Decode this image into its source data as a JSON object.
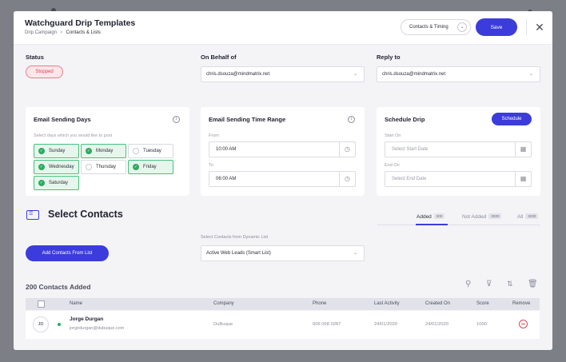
{
  "header": {
    "title": "Watchguard Drip Templates",
    "breadcrumb": [
      "Drip Campaign",
      "Contacts & Lists"
    ],
    "breadcrumb_sep": ">",
    "contacts_timing_label": "Contacts & Timing",
    "save_label": "Save",
    "close_glyph": "✕"
  },
  "status": {
    "label": "Status",
    "value": "Stopped"
  },
  "on_behalf": {
    "label": "On Behalf of",
    "value": "chris.dsouza@mindmatrix.net"
  },
  "reply_to": {
    "label": "Reply to",
    "value": "chris.dsouza@mindmatrix.net"
  },
  "sending_days": {
    "title": "Email Sending Days",
    "hint": "Select days which you would like to post",
    "days": [
      {
        "label": "Sunday",
        "selected": true
      },
      {
        "label": "Monday",
        "selected": true
      },
      {
        "label": "Tuesday",
        "selected": false
      },
      {
        "label": "Wednesday",
        "selected": true
      },
      {
        "label": "Thursday",
        "selected": false
      },
      {
        "label": "Friday",
        "selected": true
      },
      {
        "label": "Saturday",
        "selected": true
      }
    ]
  },
  "time_range": {
    "title": "Email Sending Time Range",
    "from_label": "From",
    "from_value": "10:00 AM",
    "to_label": "To",
    "to_value": "06:00 AM"
  },
  "schedule": {
    "title": "Schedule Drip",
    "button": "Schedule",
    "start_label": "Start On",
    "start_placeholder": "Select Start Date",
    "end_label": "End On",
    "end_placeholder": "Select End Date"
  },
  "select_contacts": {
    "title": "Select Contacts",
    "tabs": [
      {
        "label": "Added",
        "count": "200"
      },
      {
        "label": "Not Added",
        "count": "3030"
      },
      {
        "label": "All",
        "count": "3230"
      }
    ],
    "add_from_list": "Add Contacts From List",
    "dynamic_label": "Select Contacts from Dynamic List",
    "dynamic_value": "Active Web Leads (Smart List)"
  },
  "table": {
    "count_title": "200 Contacts Added",
    "columns": [
      "Name",
      "Company",
      "Phone",
      "Last Activity",
      "Created On",
      "Score",
      "Remove"
    ],
    "rows": [
      {
        "initials": "JD",
        "name": "Jorge Durgan",
        "email": "jorgedurgan@dubuque.com",
        "company": "DuBuque",
        "phone": "006 068 0287",
        "last_activity": "24/01/2020",
        "created_on": "24/01/2020",
        "score": "1000"
      }
    ]
  },
  "colors": {
    "accent": "#3c3cdc",
    "stopped": "#d6455a",
    "selected_day": "#2fa862"
  }
}
